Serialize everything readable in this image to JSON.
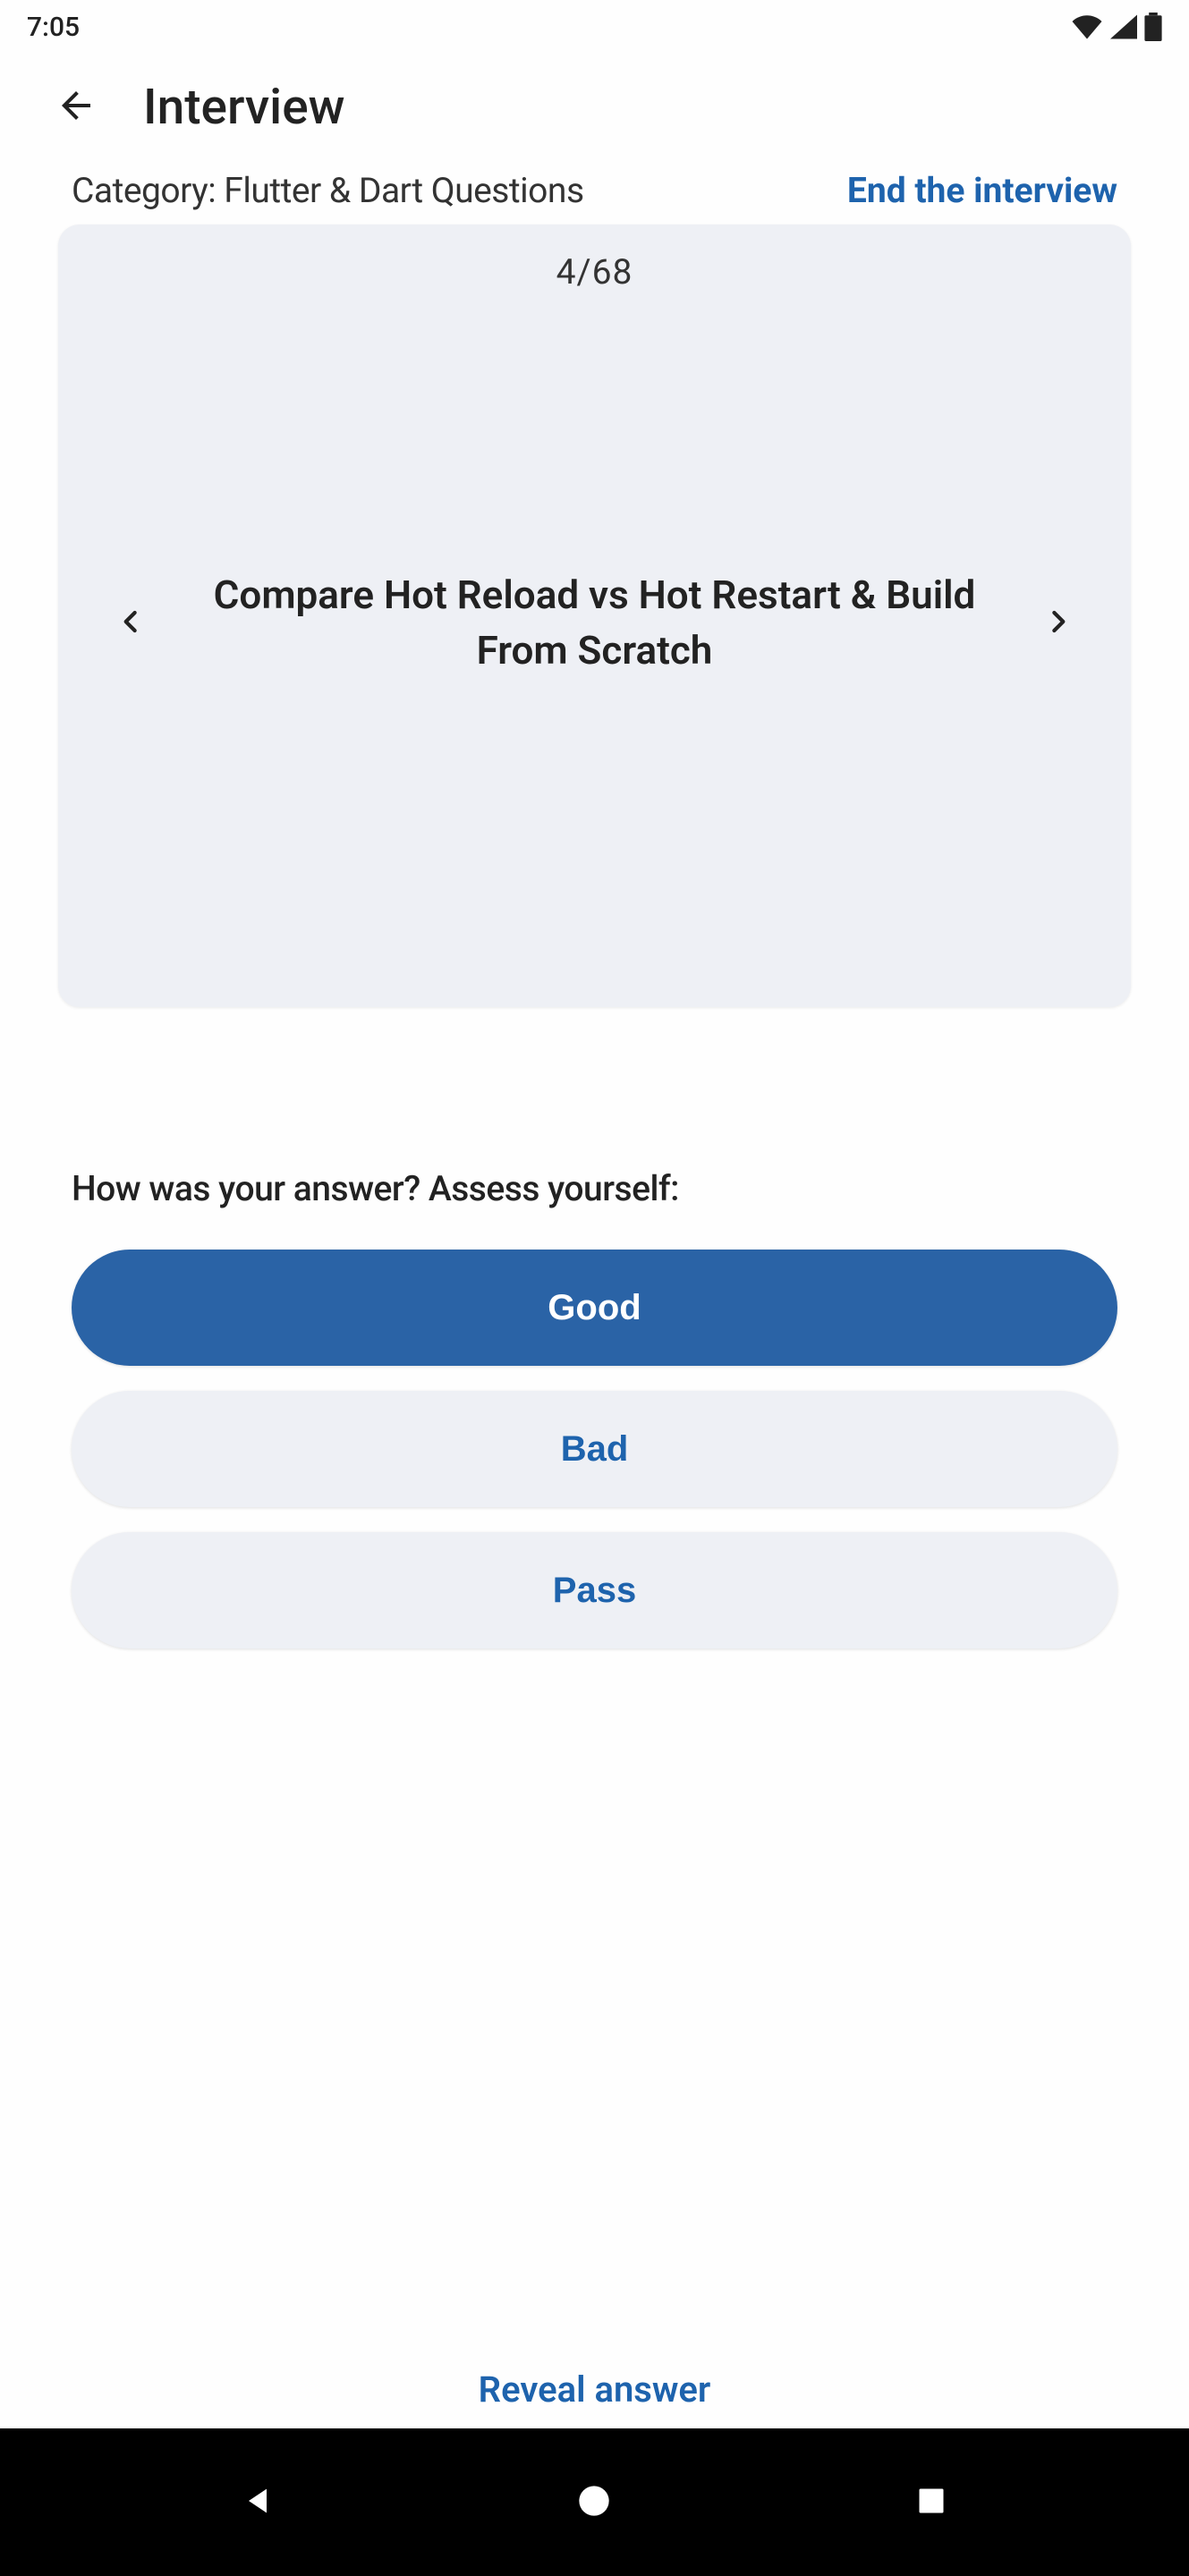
{
  "status_bar": {
    "time": "7:05"
  },
  "app_bar": {
    "title": "Interview"
  },
  "header": {
    "category_label": "Category: Flutter & Dart Questions",
    "end_link": "End the interview"
  },
  "card": {
    "current": 4,
    "total": 68,
    "counter_text": "4/68",
    "question": "Compare Hot Reload vs Hot Restart & Build From Scratch"
  },
  "assessment": {
    "prompt": "How was your answer? Assess yourself:",
    "options": {
      "good": "Good",
      "bad": "Bad",
      "pass": "Pass"
    }
  },
  "footer": {
    "reveal": "Reveal answer"
  },
  "colors": {
    "primary": "#2a63a6",
    "link": "#1e63ad",
    "card_bg": "#eef0f5"
  }
}
